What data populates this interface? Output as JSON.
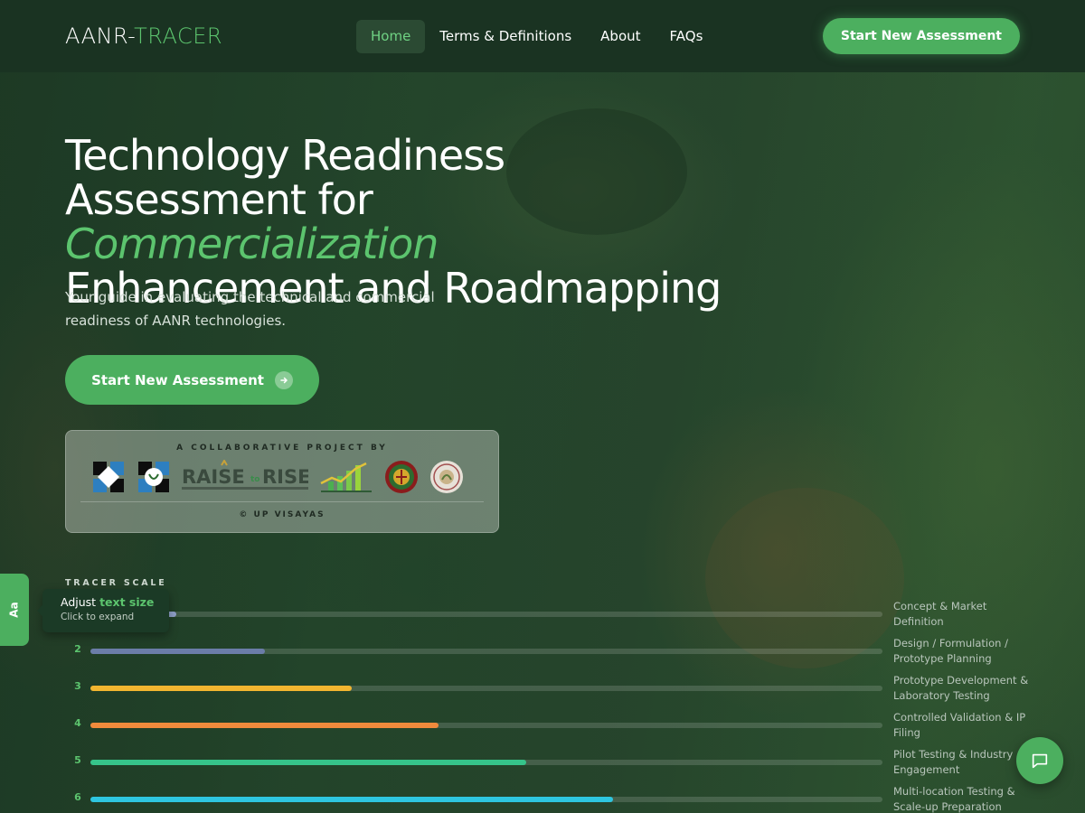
{
  "brand": {
    "part1": "AANR-",
    "part2": "TRACER"
  },
  "nav": {
    "items": [
      {
        "label": "Home",
        "active": true
      },
      {
        "label": "Terms & Definitions",
        "active": false
      },
      {
        "label": "About",
        "active": false
      },
      {
        "label": "FAQs",
        "active": false
      }
    ],
    "cta_label": "Start New Assessment"
  },
  "hero": {
    "title_line1": "Technology Readiness",
    "title_line2_prefix": "Assessment for ",
    "title_line2_accent": "Commercialization",
    "title_line3": "Enhancement and Roadmapping",
    "subtitle": "Your guide in evaluating the technical and commercial readiness of AANR technologies.",
    "cta_label": "Start New Assessment",
    "cta_icon": "arrow-right-icon"
  },
  "collab": {
    "heading": "A COLLABORATIVE PROJECT BY",
    "logo_text_raise": "RAISE",
    "logo_text_to": "to",
    "logo_text_rise": "RISE",
    "footer": "© UP VISAYAS"
  },
  "scale": {
    "title": "TRACER SCALE",
    "levels": [
      {
        "num": "1",
        "label": "Concept & Market Definition",
        "fill": 0.109,
        "color": "#8fa0c8"
      },
      {
        "num": "2",
        "label": "Design / Formulation / Prototype Planning",
        "fill": 0.22,
        "color": "#6b7da8"
      },
      {
        "num": "3",
        "label": "Prototype Development & Laboratory Testing",
        "fill": 0.33,
        "color": "#f2b530"
      },
      {
        "num": "4",
        "label": "Controlled Validation & IP Filing",
        "fill": 0.44,
        "color": "#f08a3c"
      },
      {
        "num": "5",
        "label": "Pilot Testing & Industry Engagement",
        "fill": 0.55,
        "color": "#36c48a"
      },
      {
        "num": "6",
        "label": "Multi-location Testing & Scale-up Preparation",
        "fill": 0.66,
        "color": "#2ec6e0"
      }
    ]
  },
  "text_size": {
    "tab_label": "Aa",
    "tip_prefix": "Adjust ",
    "tip_highlight": "text size",
    "tip_hint": "Click to expand"
  },
  "colors": {
    "accent": "#4caf5f",
    "accent_text": "#5cc46e",
    "header_bg": "#1a3322"
  }
}
